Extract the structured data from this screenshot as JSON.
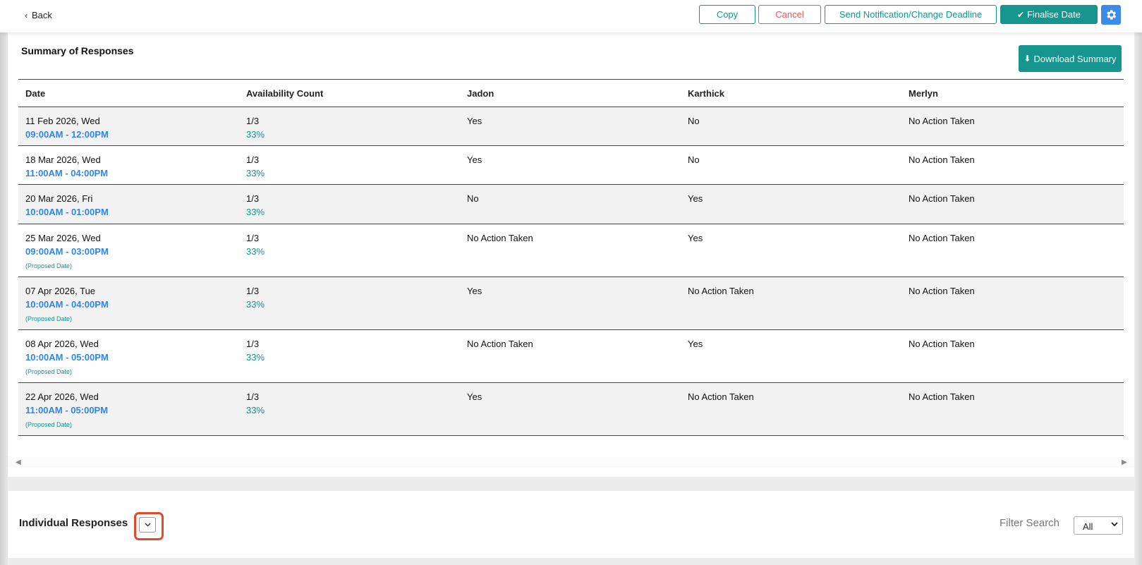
{
  "topbar": {
    "back_label": "Back",
    "copy_label": "Copy",
    "cancel_label": "Cancel",
    "send_label": "Send Notification/Change Deadline",
    "finalise_label": "Finalise Date"
  },
  "colors": {
    "accent": "#16948e",
    "danger": "#e15b5b",
    "link_blue": "#2f86e6",
    "gear_blue": "#3d8be8",
    "highlight": "#e04b2b"
  },
  "summary": {
    "title": "Summary of Responses",
    "download_label": "Download Summary",
    "columns": [
      "Date",
      "Availability Count",
      "Jadon",
      "Karthick",
      "Merlyn"
    ],
    "rows": [
      {
        "date": "11 Feb 2026, Wed",
        "time": "09:00AM - 12:00PM",
        "proposed": "",
        "count": "1/3",
        "percent": "33%",
        "jadon": "Yes",
        "karthick": "No",
        "merlyn": "No Action Taken"
      },
      {
        "date": "18 Mar 2026, Wed",
        "time": "11:00AM - 04:00PM",
        "proposed": "",
        "count": "1/3",
        "percent": "33%",
        "jadon": "Yes",
        "karthick": "No",
        "merlyn": "No Action Taken"
      },
      {
        "date": "20 Mar 2026, Fri",
        "time": "10:00AM - 01:00PM",
        "proposed": "",
        "count": "1/3",
        "percent": "33%",
        "jadon": "No",
        "karthick": "Yes",
        "merlyn": "No Action Taken"
      },
      {
        "date": "25 Mar 2026, Wed",
        "time": "09:00AM - 03:00PM",
        "proposed": "(Proposed Date)",
        "count": "1/3",
        "percent": "33%",
        "jadon": "No Action Taken",
        "karthick": "Yes",
        "merlyn": "No Action Taken"
      },
      {
        "date": "07 Apr 2026, Tue",
        "time": "10:00AM - 04:00PM",
        "proposed": "(Proposed Date)",
        "count": "1/3",
        "percent": "33%",
        "jadon": "Yes",
        "karthick": "No Action Taken",
        "merlyn": "No Action Taken"
      },
      {
        "date": "08 Apr 2026, Wed",
        "time": "10:00AM - 05:00PM",
        "proposed": "(Proposed Date)",
        "count": "1/3",
        "percent": "33%",
        "jadon": "No Action Taken",
        "karthick": "Yes",
        "merlyn": "No Action Taken"
      },
      {
        "date": "22 Apr 2026, Wed",
        "time": "11:00AM - 05:00PM",
        "proposed": "(Proposed Date)",
        "count": "1/3",
        "percent": "33%",
        "jadon": "Yes",
        "karthick": "No Action Taken",
        "merlyn": "No Action Taken"
      }
    ]
  },
  "individual": {
    "title": "Individual Responses",
    "filter_label": "Filter Search",
    "filter_value": "All"
  }
}
